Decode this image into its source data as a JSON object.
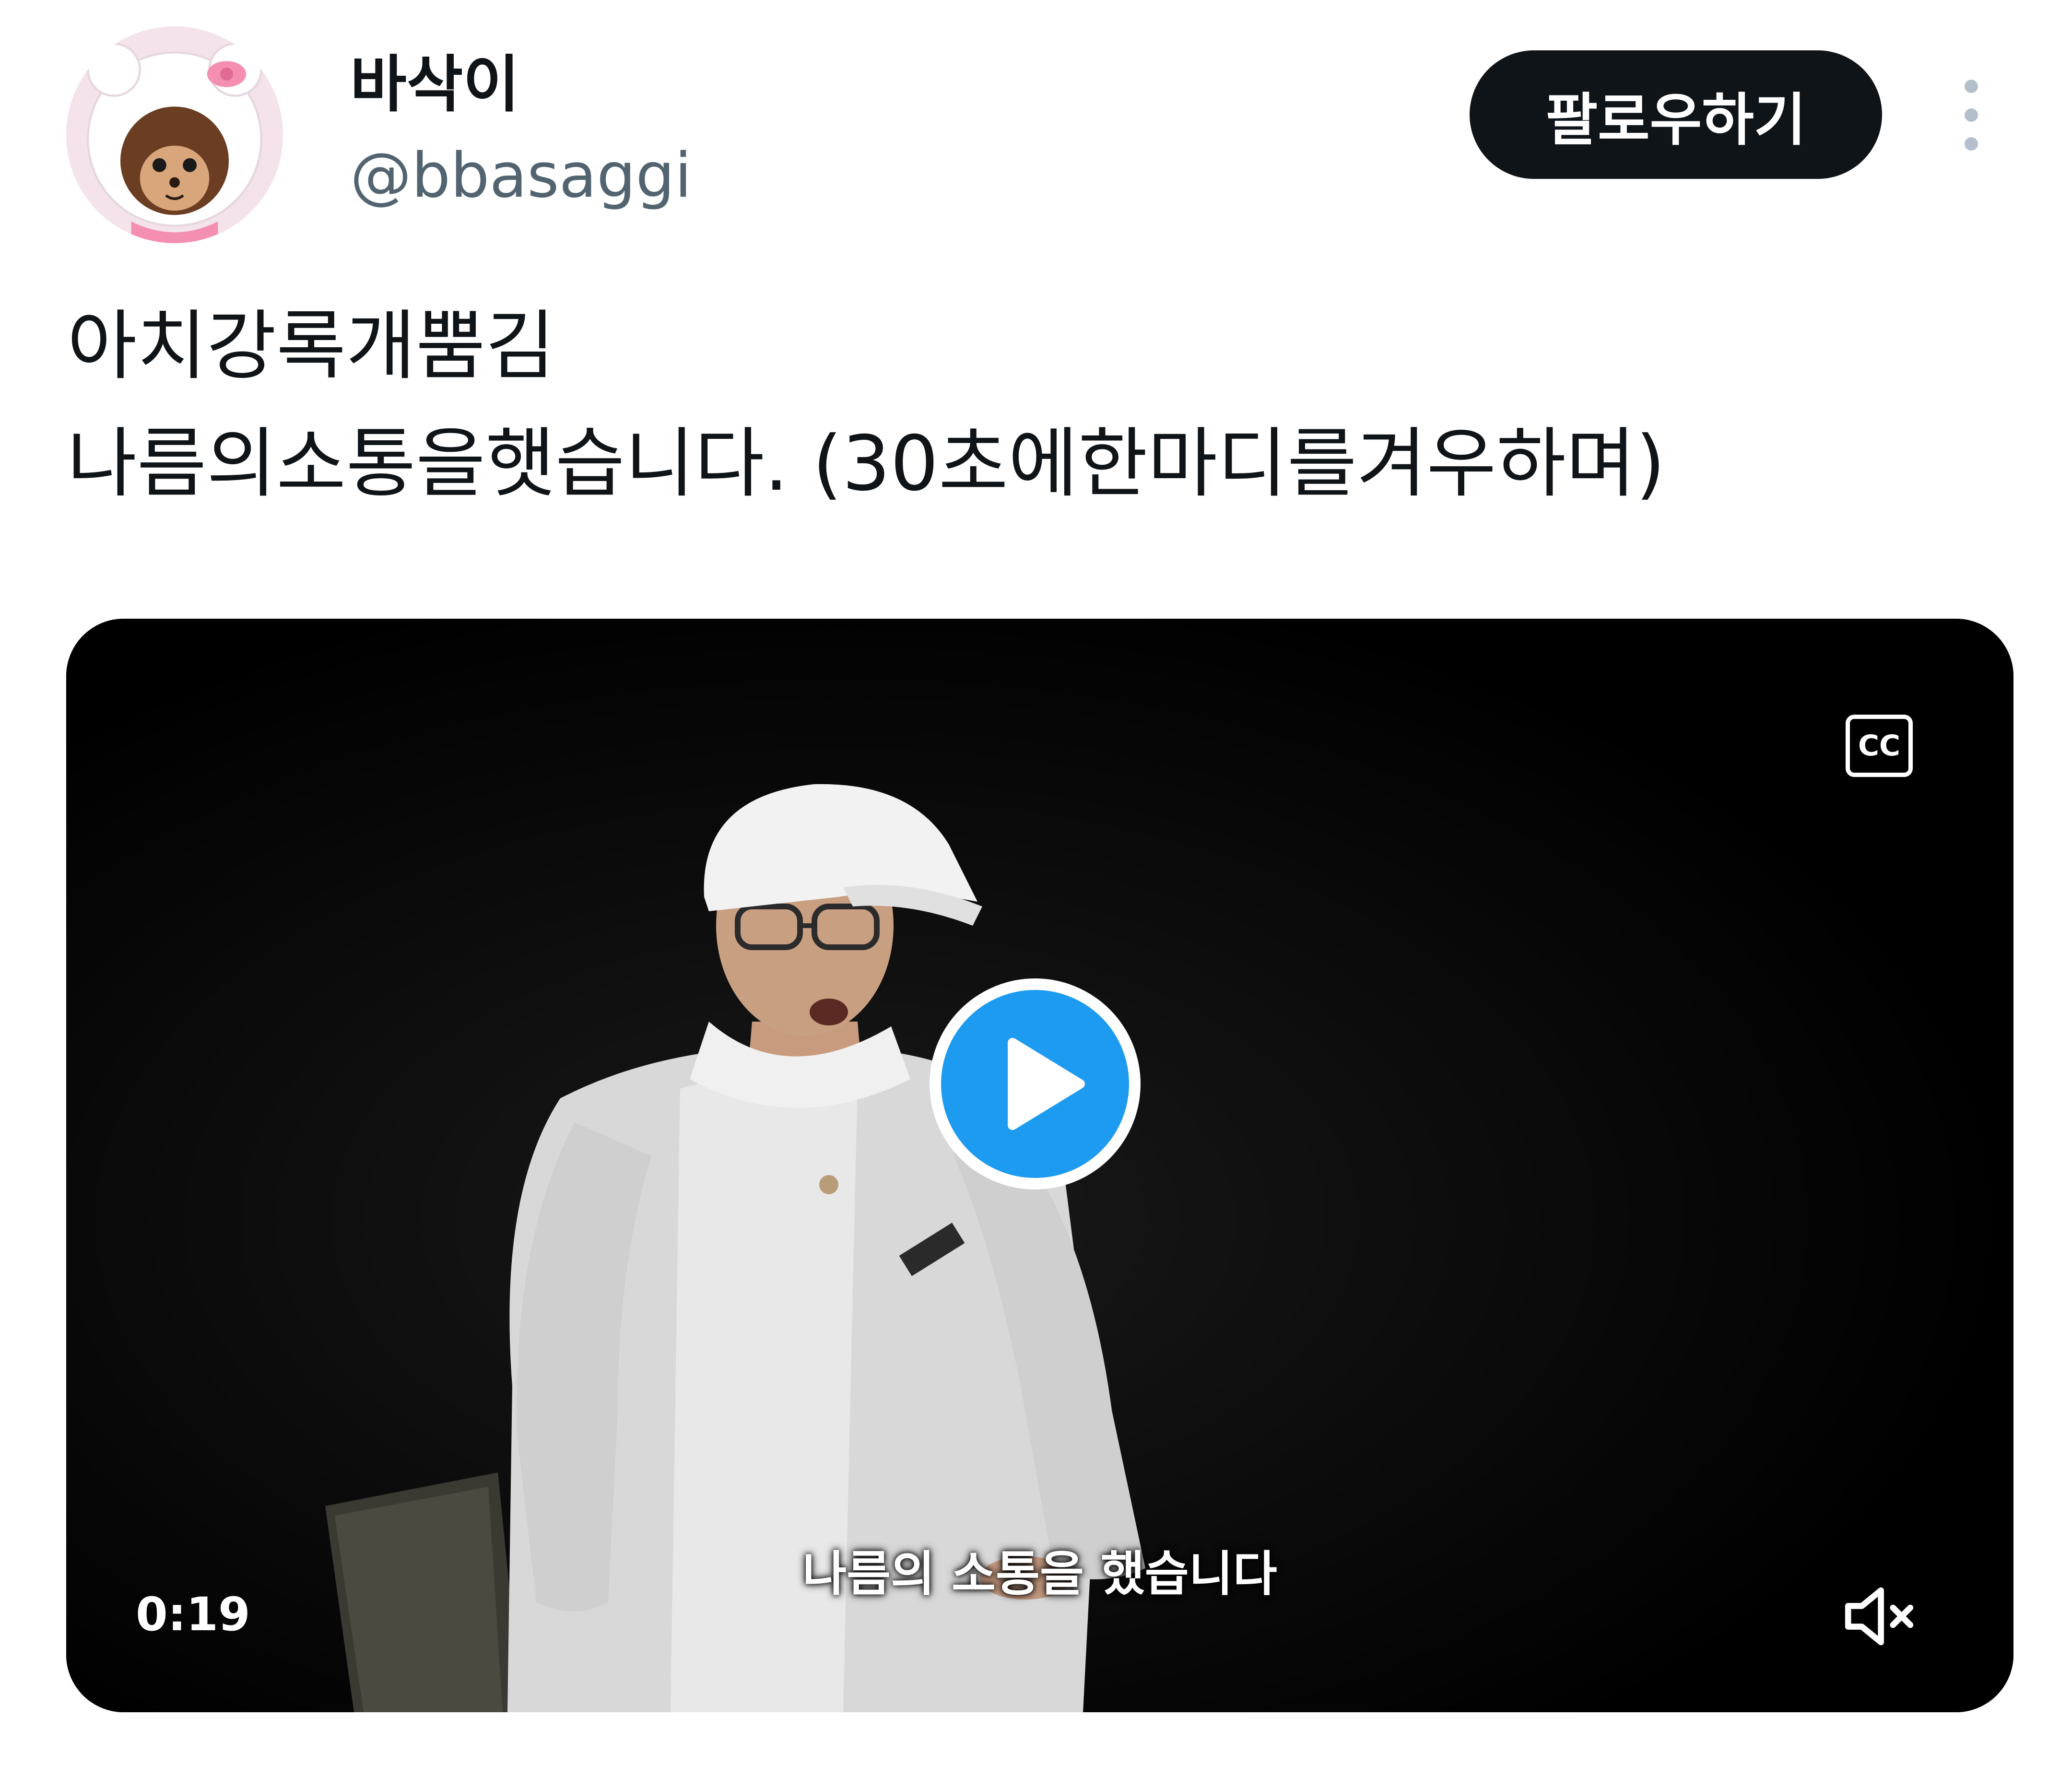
{
  "user": {
    "display_name": "바삭이",
    "handle": "@bbasaggi",
    "avatar_icon": "monchhichi-avatar"
  },
  "actions": {
    "follow_label": "팔로우하기",
    "more_icon": "more-vertical-icon"
  },
  "tweet": {
    "lines": [
      "아치강록개뿜김",
      "나름의소통을햇습니다. (30초에한마디를겨우하며)"
    ]
  },
  "video": {
    "cc_label": "CC",
    "subtitle": "나름의 소통을 했습니다",
    "timestamp": "0:19",
    "play_icon": "play-icon",
    "mute_icon": "volume-muted-icon",
    "accent_color": "#1d9bf0"
  },
  "colors": {
    "text_primary": "#0f1419",
    "text_secondary": "#536471",
    "button_dark": "#0f1419",
    "video_bg": "#000000"
  }
}
